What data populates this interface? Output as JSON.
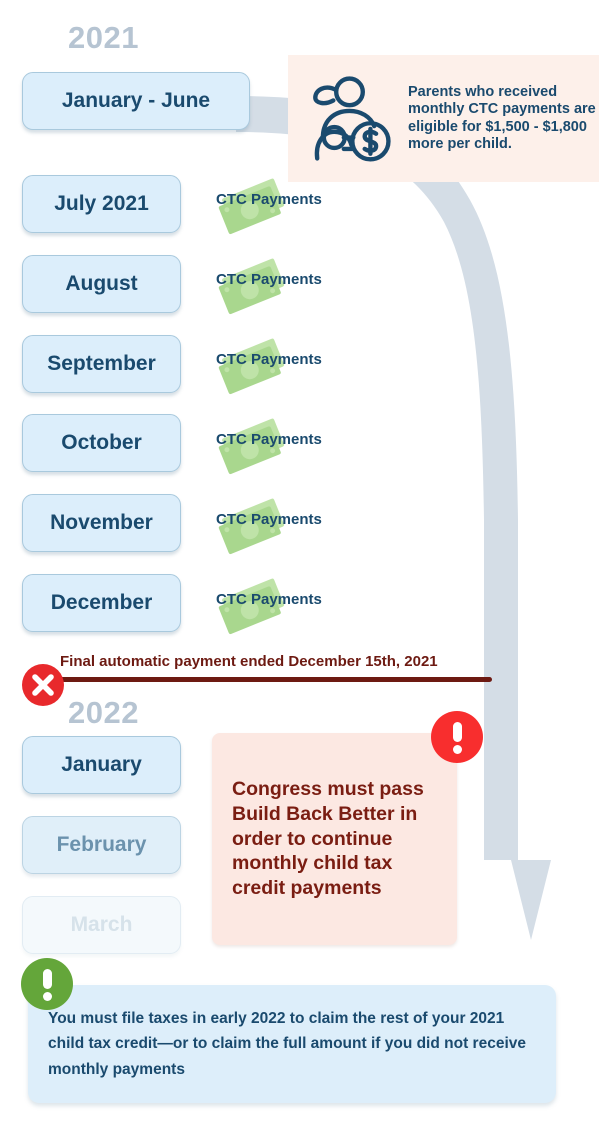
{
  "sections": {
    "year_2021": "2021",
    "year_2022": "2022"
  },
  "months_2021": [
    {
      "label": "January - June",
      "wide": true,
      "has_payment": false
    },
    {
      "label": "July 2021",
      "wide": false,
      "has_payment": true
    },
    {
      "label": "August",
      "wide": false,
      "has_payment": true
    },
    {
      "label": "September",
      "wide": false,
      "has_payment": true
    },
    {
      "label": "October",
      "wide": false,
      "has_payment": true
    },
    {
      "label": "November",
      "wide": false,
      "has_payment": true
    },
    {
      "label": "December",
      "wide": false,
      "has_payment": true
    }
  ],
  "months_2022": [
    {
      "label": "January",
      "fade": "none"
    },
    {
      "label": "February",
      "fade": "partial"
    },
    {
      "label": "March",
      "fade": "heavy"
    }
  ],
  "payment_label": "CTC Payments",
  "callout_top": {
    "text": "Parents who received monthly CTC payments are eligible for $1,500 - $1,800 more per child.",
    "icon": "parent-child-dollar-icon",
    "background": "#fdf0ea"
  },
  "final_payment": {
    "text": "Final automatic payment ended December 15th, 2021",
    "icon": "red-x-icon",
    "color": "#6d1a12"
  },
  "callout_congress": {
    "text": "Congress must pass Build Back Better in order to continue monthly child tax credit payments",
    "badge_icon": "red-alert-icon",
    "background": "#fce8e2",
    "text_color": "#7a1d12"
  },
  "callout_bottom": {
    "text": "You must file taxes in early 2022 to claim the rest of your 2021 child tax credit—or to claim the full amount if you did not receive monthly payments",
    "badge_icon": "green-alert-icon",
    "background": "#ddeefa",
    "text_color": "#1a4a6e"
  },
  "colors": {
    "pill_fill": "#dceefb",
    "pill_border": "#a9c9dd",
    "navy_text": "#1a4a6e",
    "year_gray": "#b6c4d2",
    "flow_arrow": "#d4dde6",
    "money_green": "#a9d78e",
    "alert_red": "#f82e2e",
    "alert_green": "#64a63a"
  }
}
